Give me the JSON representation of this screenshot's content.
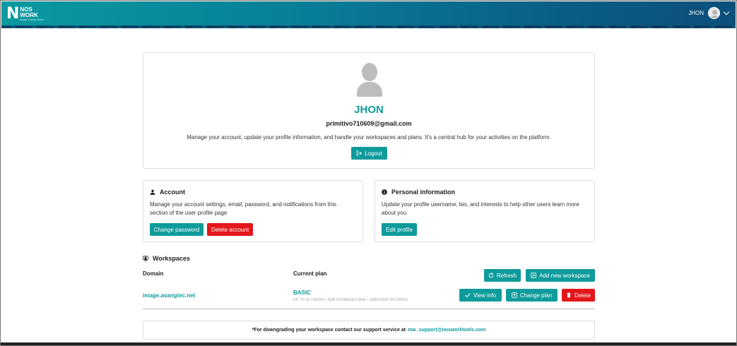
{
  "header": {
    "logo_mark": "N",
    "logo_line1": "NOS",
    "logo_line2": "WORK",
    "logo_tagline": "WORK TOOLS SUITE",
    "user_name": "JHON"
  },
  "profile": {
    "name": "JHON",
    "email": "primitivo710609@gmail.com",
    "description": "Manage your account, update your profile information, and handle your workspaces and plans. It's a central hub for your activities on the platform.",
    "logout_label": "Logout"
  },
  "account": {
    "title": "Account",
    "description": "Manage your account settings, email, password, and notifications from this section of the user profile page",
    "change_password_label": "Change password",
    "delete_account_label": "Delete account"
  },
  "personal_info": {
    "title": "Personal information",
    "description": "Update your profile username, bio, and interests to help other users learn more about you",
    "edit_profile_label": "Edit profile"
  },
  "workspaces": {
    "title": "Workspaces",
    "col_domain": "Domain",
    "col_plan": "Current plan",
    "refresh_label": "Refresh",
    "add_label": "Add new workspace",
    "rows": [
      {
        "domain": "image.avangtec.net",
        "plan": "BASIC",
        "plan_detail": "UP TO 25 USERS • 6GB STORAGE/USER • 3GB/USER ON DRIVE",
        "view_label": "View info",
        "change_plan_label": "Change plan",
        "delete_label": "Delete"
      }
    ]
  },
  "support": {
    "text": "*For downgrading your workspace contact our support service at",
    "email": "mw_support@nosworktools.com"
  },
  "colors": {
    "accent": "#0f9b9b",
    "danger": "#e3171b"
  }
}
